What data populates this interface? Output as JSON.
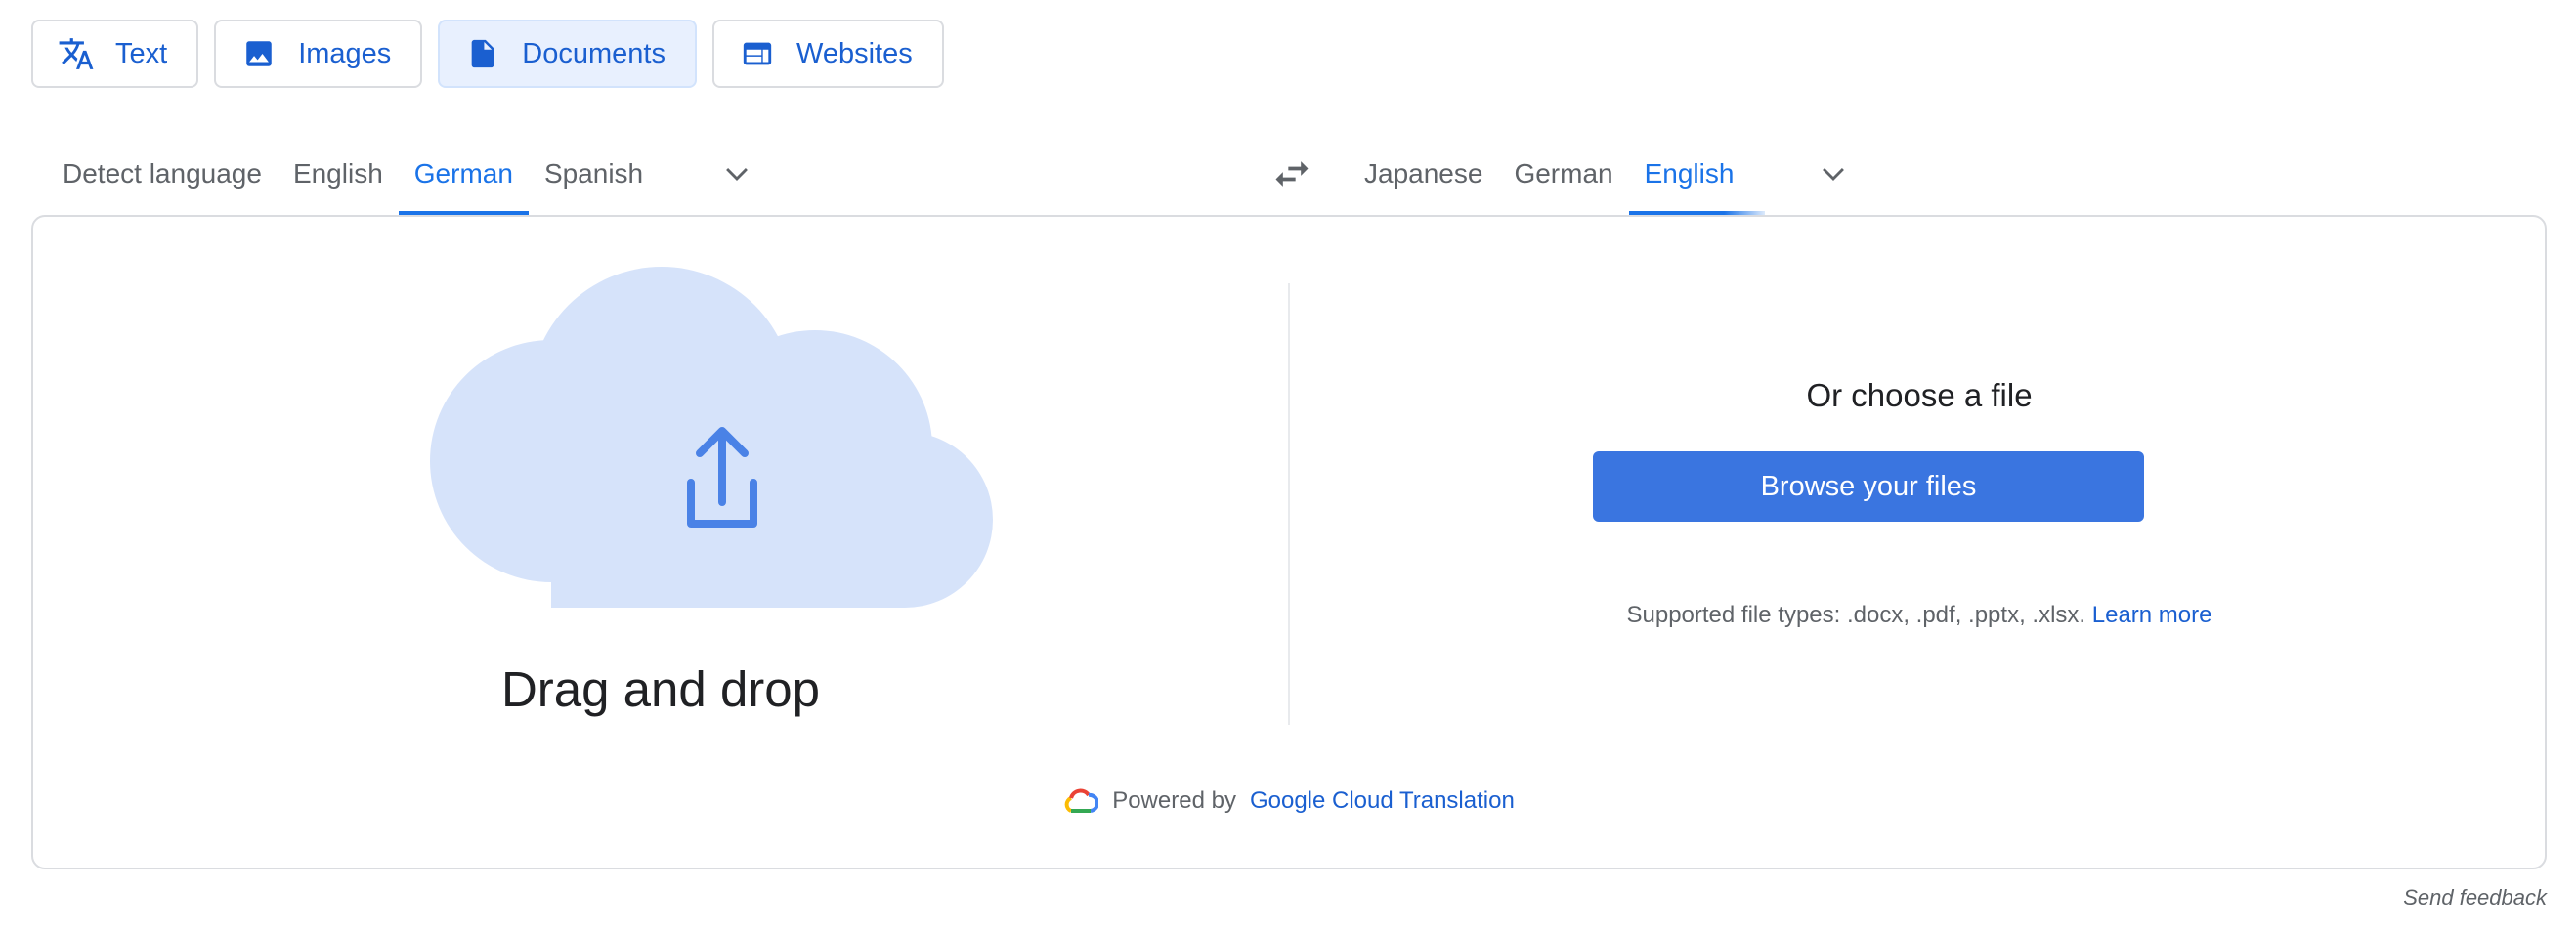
{
  "mode_tabs": [
    {
      "label": "Text",
      "icon": "translate-icon",
      "active": false
    },
    {
      "label": "Images",
      "icon": "image-icon",
      "active": false
    },
    {
      "label": "Documents",
      "icon": "document-icon",
      "active": true
    },
    {
      "label": "Websites",
      "icon": "web-icon",
      "active": false
    }
  ],
  "source_languages": {
    "tabs": [
      "Detect language",
      "English",
      "German",
      "Spanish"
    ],
    "selected": "German",
    "more_icon": "chevron-down-icon"
  },
  "swap_icon": "swap-horiz-icon",
  "target_languages": {
    "tabs": [
      "Japanese",
      "German",
      "English"
    ],
    "selected": "English",
    "more_icon": "chevron-down-icon"
  },
  "upload": {
    "drag_drop_label": "Drag and drop",
    "cloud_icon": "cloud-upload-icon"
  },
  "file_picker": {
    "title": "Or choose a file",
    "browse_label": "Browse your files",
    "supported_prefix": "Supported file types: .docx, .pdf, .pptx, .xlsx.",
    "learn_more": "Learn more"
  },
  "footer": {
    "powered_by": "Powered by",
    "service_name": "Google Cloud Translation",
    "send_feedback": "Send feedback"
  },
  "colors": {
    "accent": "#1a73e8",
    "button": "#3a75e0",
    "active_tab_bg": "#e8f0fe",
    "cloud_fill": "#d6e3fa",
    "upload_arrow": "#4a82e6"
  }
}
